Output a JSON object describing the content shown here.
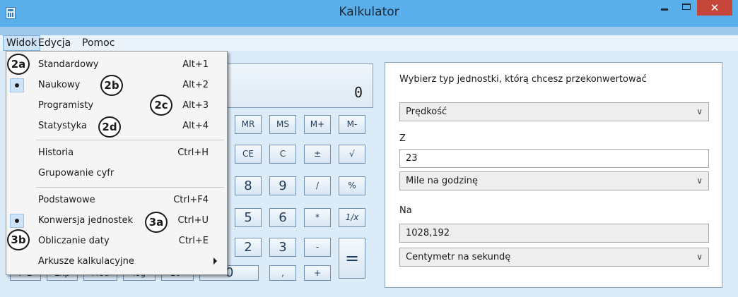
{
  "window": {
    "title": "Kalkulator",
    "close_glyph": "✕"
  },
  "menubar": {
    "items": [
      "Widok",
      "Edycja",
      "Pomoc"
    ]
  },
  "display": {
    "value": "0"
  },
  "keypad": {
    "memory": [
      "MR",
      "MS",
      "M+",
      "M-"
    ],
    "row2": [
      "CE",
      "C",
      "±",
      "√"
    ],
    "row3": [
      "8",
      "9",
      "/",
      "%"
    ],
    "row4": [
      "5",
      "6",
      "*",
      "1/x"
    ],
    "row5": [
      "2",
      "3",
      "-"
    ],
    "equals": "=",
    "row6": [
      "0",
      ",",
      "+"
    ],
    "sci_bottom": [
      "F-E",
      "Exp",
      "Mod",
      "log",
      "10ˣ"
    ]
  },
  "menu": {
    "items": [
      {
        "label": "Standardowy",
        "shortcut": "Alt+1"
      },
      {
        "label": "Naukowy",
        "shortcut": "Alt+2"
      },
      {
        "label": "Programisty",
        "shortcut": "Alt+3"
      },
      {
        "label": "Statystyka",
        "shortcut": "Alt+4"
      },
      {
        "label": "Historia",
        "shortcut": "Ctrl+H"
      },
      {
        "label": "Grupowanie cyfr",
        "shortcut": ""
      },
      {
        "label": "Podstawowe",
        "shortcut": "Ctrl+F4"
      },
      {
        "label": "Konwersja jednostek",
        "shortcut": "Ctrl+U"
      },
      {
        "label": "Obliczanie daty",
        "shortcut": "Ctrl+E"
      },
      {
        "label": "Arkusze kalkulacyjne",
        "shortcut": ""
      }
    ]
  },
  "callouts": [
    "2a",
    "2b",
    "2c",
    "2d",
    "3a",
    "3b"
  ],
  "converter": {
    "prompt": "Wybierz typ jednostki, którą chcesz przekonwertować",
    "type": "Prędkość",
    "from_label": "Z",
    "from_value": "23",
    "from_unit": "Mile na godzinę",
    "to_label": "Na",
    "to_value": "1028,192",
    "to_unit": "Centymetr na sekundę"
  },
  "icons": {
    "chevron": "chevron-down-icon",
    "app": "calculator-icon",
    "submenu": "chevron-right-icon"
  }
}
